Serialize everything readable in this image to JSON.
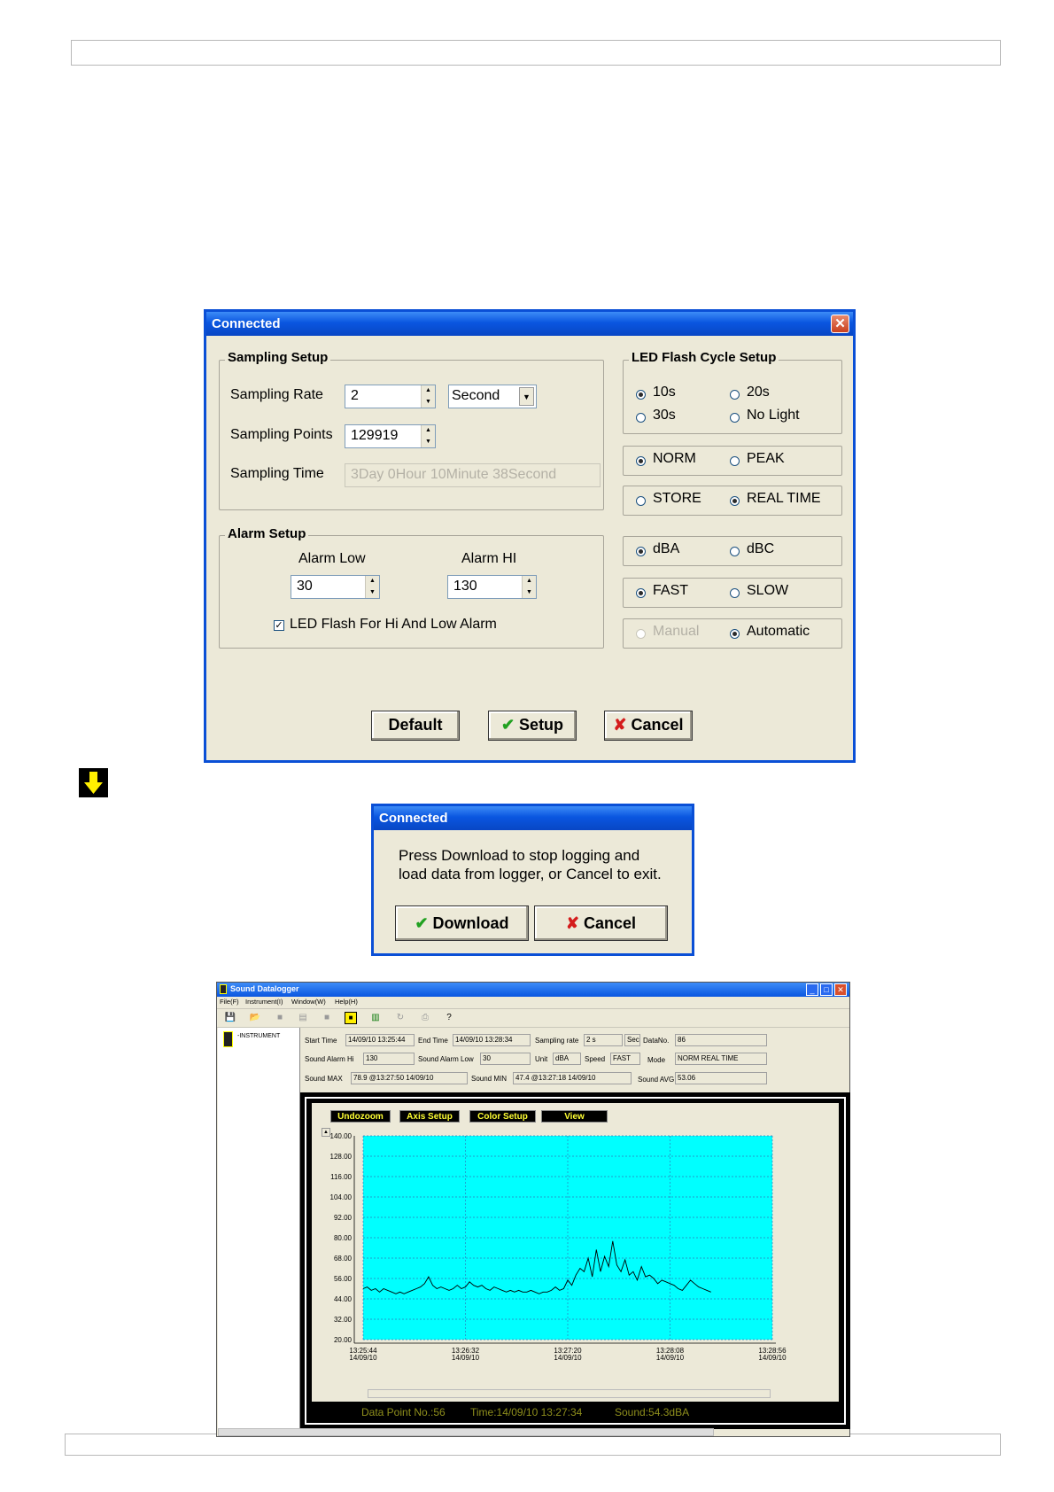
{
  "setup_dialog": {
    "title": "Connected",
    "sampling_setup": {
      "heading": "Sampling Setup",
      "rate_label": "Sampling Rate",
      "rate_value": "2",
      "rate_unit": "Second",
      "points_label": "Sampling Points",
      "points_value": "129919",
      "time_label": "Sampling Time",
      "time_value": "3Day 0Hour 10Minute 38Second"
    },
    "alarm_setup": {
      "heading": "Alarm Setup",
      "low_label": "Alarm Low",
      "low_value": "30",
      "hi_label": "Alarm HI",
      "hi_value": "130",
      "led_label": "LED Flash For Hi And Low  Alarm",
      "led_checked": true
    },
    "led_flash": {
      "heading": "LED Flash Cycle Setup",
      "options": [
        "10s",
        "20s",
        "30s",
        "No Light"
      ],
      "selected": "10s"
    },
    "mode_groups": [
      {
        "a": "NORM",
        "b": "PEAK",
        "selected": "NORM"
      },
      {
        "a": "STORE",
        "b": "REAL TIME",
        "selected": "REAL TIME"
      },
      {
        "a": "dBA",
        "b": "dBC",
        "selected": "dBA"
      },
      {
        "a": "FAST",
        "b": "SLOW",
        "selected": "FAST"
      },
      {
        "a": "Manual",
        "b": "Automatic",
        "selected": "Automatic"
      }
    ],
    "buttons": {
      "default": "Default",
      "setup": "Setup",
      "cancel": "Cancel"
    }
  },
  "download_dialog": {
    "title": "Connected",
    "message": "Press Download to stop logging and load data from logger, or Cancel to exit.",
    "download": "Download",
    "cancel": "Cancel"
  },
  "app": {
    "title": "Sound Datalogger",
    "menu": [
      "File(F)",
      "Instrument(I)",
      "Window(W)",
      "Help(H)"
    ],
    "tree_item": "-INSTRUMENT",
    "info": {
      "start_time_label": "Start Time",
      "start_time": "14/09/10 13:25:44",
      "end_time_label": "End Time",
      "end_time": "14/09/10 13:28:34",
      "rate_label": "Sampling rate",
      "rate": "2 s",
      "rate_unit": "Sec",
      "datano_label": "DataNo.",
      "datano": "86",
      "alarm_hi_label": "Sound Alarm Hi",
      "alarm_hi": "130",
      "alarm_low_label": "Sound Alarm Low",
      "alarm_low": "30",
      "unit_label": "Unit",
      "unit": "dBA",
      "speed_label": "Speed",
      "speed": "FAST",
      "mode_label": "Mode",
      "mode": "NORM REAL TIME",
      "max_label": "Sound MAX",
      "max": "78.9 @13:27:50 14/09/10",
      "min_label": "Sound MIN",
      "min": "47.4 @13:27:18 14/09/10",
      "avg_label": "Sound AVG",
      "avg": "53.06"
    },
    "chart_buttons": [
      "Undozoom",
      "Axis Setup",
      "Color Setup",
      "View"
    ],
    "status": {
      "points": "Data Point No.:56",
      "time": "Time:14/09/10 13:27:34",
      "sound": "Sound:54.3dBA"
    },
    "colors": {
      "plot_bg": "#00ffff",
      "line": "#000000",
      "frame": "#000000",
      "status_text": "#ffff33"
    }
  },
  "chart_data": {
    "type": "line",
    "ylim": [
      20,
      140
    ],
    "yticks": [
      "140.00",
      "128.00",
      "116.00",
      "104.00",
      "92.00",
      "80.00",
      "68.00",
      "56.00",
      "44.00",
      "32.00",
      "20.00"
    ],
    "xticks": [
      {
        "time": "13:25:44",
        "date": "14/09/10"
      },
      {
        "time": "13:26:32",
        "date": "14/09/10"
      },
      {
        "time": "13:27:20",
        "date": "14/09/10"
      },
      {
        "time": "13:28:08",
        "date": "14/09/10"
      },
      {
        "time": "13:28:56",
        "date": "14/09/10"
      }
    ],
    "grid": true,
    "series": [
      {
        "values": [
          50,
          51,
          49,
          50,
          48,
          50,
          49,
          48,
          47,
          48,
          47,
          48,
          49,
          50,
          51,
          53,
          57,
          52,
          50,
          51,
          50,
          49,
          50,
          52,
          50,
          51,
          54,
          52,
          51,
          52,
          50,
          49,
          51,
          50,
          49,
          48,
          49,
          48,
          49,
          48,
          48,
          49,
          48,
          47,
          48,
          48,
          49,
          51,
          49,
          50,
          55,
          52,
          58,
          62,
          60,
          68,
          57,
          73,
          60,
          69,
          63,
          78,
          64,
          60,
          67,
          58,
          60,
          55,
          63,
          57,
          58,
          56,
          53,
          55,
          54,
          53,
          52,
          50,
          49,
          52,
          55,
          53,
          51,
          50,
          49,
          48
        ]
      }
    ]
  }
}
